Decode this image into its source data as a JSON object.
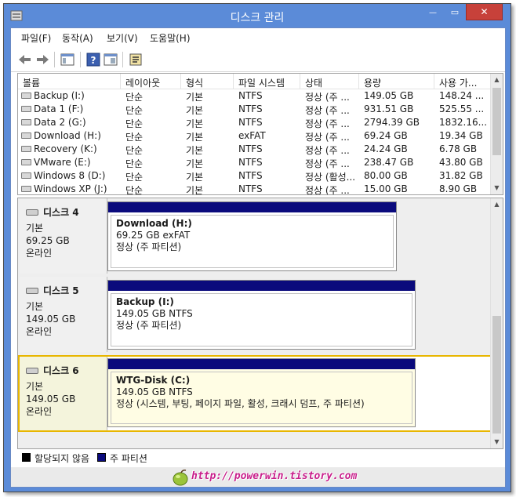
{
  "window": {
    "title": "디스크 관리",
    "close_glyph": "✕",
    "min_glyph": "—",
    "max_glyph": "▭"
  },
  "menu": [
    "파일(F)",
    "동작(A)",
    "보기(V)",
    "도움말(H)"
  ],
  "toolbar": {
    "buttons": [
      "back-arrow-icon",
      "forward-arrow-icon",
      "console-tree-icon",
      "help-icon",
      "properties-icon",
      "disk-settings-icon"
    ]
  },
  "volume_list": {
    "columns": [
      "볼륨",
      "레이아웃",
      "형식",
      "파일 시스템",
      "상태",
      "용량",
      "사용 가..."
    ],
    "rows": [
      {
        "name": "Backup (I:)",
        "layout": "단순",
        "type": "기본",
        "fs": "NTFS",
        "status": "정상 (주 ...",
        "capacity": "149.05 GB",
        "free": "148.24 ..."
      },
      {
        "name": "Data 1 (F:)",
        "layout": "단순",
        "type": "기본",
        "fs": "NTFS",
        "status": "정상 (주 ...",
        "capacity": "931.51 GB",
        "free": "525.55 ..."
      },
      {
        "name": "Data 2 (G:)",
        "layout": "단순",
        "type": "기본",
        "fs": "NTFS",
        "status": "정상 (주 ...",
        "capacity": "2794.39 GB",
        "free": "1832.16..."
      },
      {
        "name": "Download (H:)",
        "layout": "단순",
        "type": "기본",
        "fs": "exFAT",
        "status": "정상 (주 ...",
        "capacity": "69.24 GB",
        "free": "19.34 GB"
      },
      {
        "name": "Recovery (K:)",
        "layout": "단순",
        "type": "기본",
        "fs": "NTFS",
        "status": "정상 (주 ...",
        "capacity": "24.24 GB",
        "free": "6.78 GB"
      },
      {
        "name": "VMware (E:)",
        "layout": "단순",
        "type": "기본",
        "fs": "NTFS",
        "status": "정상 (주 ...",
        "capacity": "238.47 GB",
        "free": "43.80 GB"
      },
      {
        "name": "Windows 8 (D:)",
        "layout": "단순",
        "type": "기본",
        "fs": "NTFS",
        "status": "정상 (활성...",
        "capacity": "80.00 GB",
        "free": "31.82 GB"
      },
      {
        "name": "Windows XP (J:)",
        "layout": "단순",
        "type": "기본",
        "fs": "NTFS",
        "status": "정상 (주 ...",
        "capacity": "15.00 GB",
        "free": "8.90 GB"
      }
    ]
  },
  "disks": [
    {
      "title": "디스크 4",
      "kind": "기본",
      "size": "69.25 GB",
      "state": "온라인",
      "partition": {
        "name": "Download  (H:)",
        "detail": "69.25 GB exFAT",
        "status": "정상 (주 파티션)"
      }
    },
    {
      "title": "디스크 5",
      "kind": "기본",
      "size": "149.05 GB",
      "state": "온라인",
      "partition": {
        "name": "Backup  (I:)",
        "detail": "149.05 GB NTFS",
        "status": "정상 (주 파티션)"
      }
    },
    {
      "title": "디스크 6",
      "kind": "기본",
      "size": "149.05 GB",
      "state": "온라인",
      "partition": {
        "name": "WTG-Disk  (C:)",
        "detail": "149.05 GB NTFS",
        "status": "정상 (시스템, 부팅, 페이지 파일, 활성, 크래시 덤프, 주 파티션)"
      }
    }
  ],
  "legend": [
    {
      "label": "할당되지 않음",
      "color": "#000000"
    },
    {
      "label": "주 파티션",
      "color": "#0a0a7c"
    }
  ],
  "watermark": "http://powerwin.tistory.com",
  "colors": {
    "title_bar": "#5b8bd8",
    "close_button": "#c7413a",
    "selection_border": "#e8b600",
    "partition_header": "#0a0a7c"
  }
}
